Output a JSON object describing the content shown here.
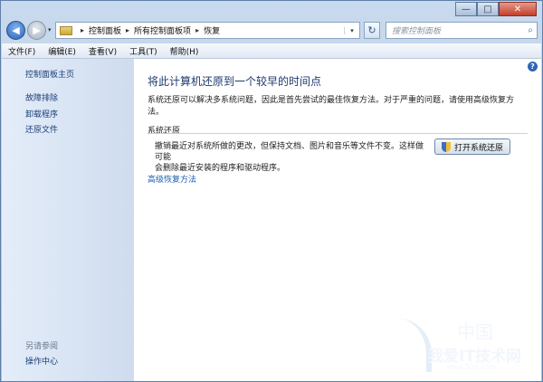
{
  "window": {
    "caption": {
      "minimize": "—",
      "maximize": "□",
      "close": "✕"
    }
  },
  "nav": {
    "back_icon": "◀",
    "forward_icon": "▶",
    "dropdown_icon": "▾",
    "breadcrumb": [
      "控制面板",
      "所有控制面板项",
      "恢复"
    ],
    "separator": "▸",
    "refresh_icon": "↻",
    "search_placeholder": "搜索控制面板",
    "search_icon": "⌕"
  },
  "menubar": [
    "文件(F)",
    "编辑(E)",
    "查看(V)",
    "工具(T)",
    "帮助(H)"
  ],
  "sidebar": {
    "home": "控制面板主页",
    "links": [
      "故障排除",
      "卸载程序",
      "还原文件"
    ],
    "see_also_label": "另请参阅",
    "see_also_links": [
      "操作中心"
    ]
  },
  "main": {
    "help_icon": "?",
    "title": "将此计算机还原到一个较早的时间点",
    "description": "系统还原可以解决多系统问题，因此是首先尝试的最佳恢复方法。对于严重的问题，请使用高级恢复方法。",
    "section_header": "系统还原",
    "restore_desc_line1": "撤销最近对系统所做的更改，但保持文档、图片和音乐等文件不变。这样做可能",
    "restore_desc_line2": "会删除最近安装的程序和驱动程序。",
    "restore_button": "打开系统还原",
    "advanced_link": "高级恢复方法"
  },
  "watermark": {
    "top": "中国",
    "text": "我爱IT技术网",
    "url": "www.52ij.com"
  }
}
